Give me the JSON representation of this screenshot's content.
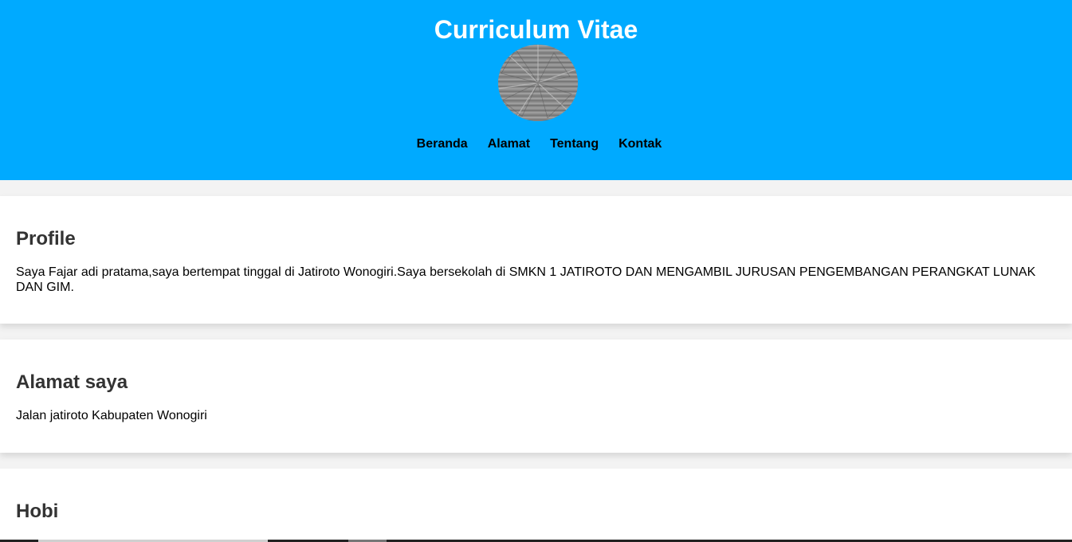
{
  "header": {
    "title": "Curriculum Vitae",
    "bg_color": "#00aaff",
    "avatar_icon": "woven-pattern-profile-photo"
  },
  "nav": {
    "items": [
      {
        "label": "Beranda"
      },
      {
        "label": "Alamat"
      },
      {
        "label": "Tentang"
      },
      {
        "label": "Kontak"
      }
    ]
  },
  "sections": {
    "profile": {
      "heading": "Profile",
      "text": "Saya Fajar adi pratama,saya bertempat tinggal di Jatiroto Wonogiri.Saya bersekolah di SMKN 1 JATIROTO DAN MENGAMBIL JURUSAN PENGEMBANGAN PERANGKAT LUNAK DAN GIM."
    },
    "alamat": {
      "heading": "Alamat saya",
      "text": "Jalan jatiroto Kabupaten Wonogiri"
    },
    "hobi": {
      "heading": "Hobi"
    }
  }
}
